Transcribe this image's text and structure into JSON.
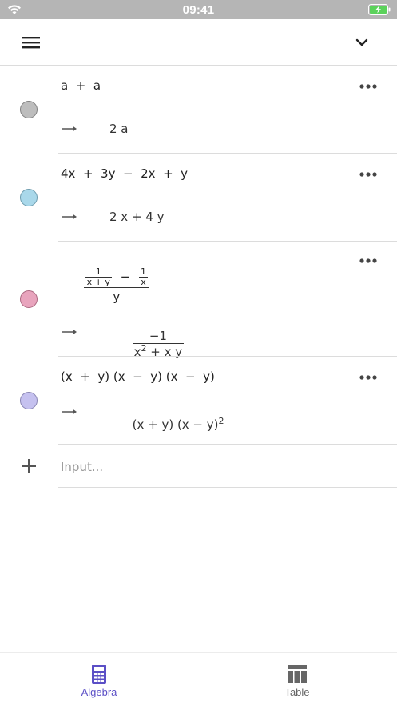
{
  "status_bar": {
    "time": "09:41",
    "icons": [
      "wifi-icon",
      "battery-charging-icon"
    ]
  },
  "app_bar": {
    "icons": [
      "menu-icon",
      "chevron-down-icon"
    ]
  },
  "colors": {
    "accent": "#5b4fc6",
    "separator": "#dcdcdc",
    "inactive": "#666666"
  },
  "rows": [
    {
      "marble_color": "#bdbdbd",
      "input": "a  +  a",
      "output": "2 a"
    },
    {
      "marble_color": "#a9d8ea",
      "input": "4x  +  3y  −  2x  +  y",
      "output": "2 x + 4 y"
    },
    {
      "marble_color": "#e8a4bd",
      "input": {
        "inner_num": "1",
        "inner_den": "x + y",
        "minus": "−",
        "second_num": "1",
        "second_den": "x",
        "outer_den": "y"
      },
      "output": {
        "num": "−1",
        "den_base": "x",
        "den_exp": "2",
        "den_rest": " + x y"
      }
    },
    {
      "marble_color": "#c5c1ef",
      "input": "(x  +  y) (x  −  y) (x  −  y)",
      "output": {
        "base": "(x + y) (x − y)",
        "exp": "2"
      }
    }
  ],
  "add_input": {
    "placeholder": "Input..."
  },
  "bottom_nav": {
    "items": [
      {
        "label": "Algebra",
        "icon": "calculator-icon",
        "active": true
      },
      {
        "label": "Table",
        "icon": "table-icon",
        "active": false
      }
    ]
  }
}
